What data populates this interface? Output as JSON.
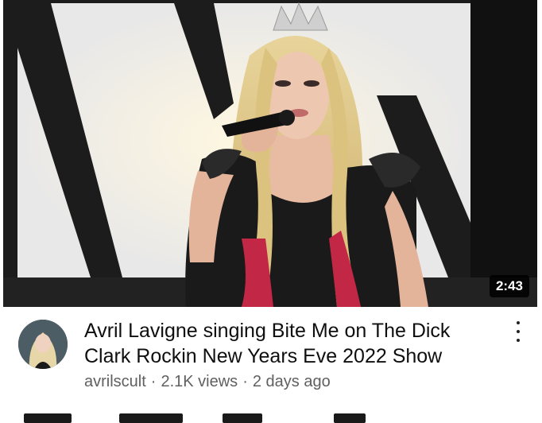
{
  "video": {
    "duration": "2:43",
    "thumbnail_icon": "concert-performance-thumbnail",
    "title": "Avril Lavigne singing Bite Me on The Dick Clark Rockin New Years Eve 2022 Show",
    "channel": "avrilscult",
    "views": "2.1K views",
    "age": "2 days ago",
    "separator": "·"
  },
  "icons": {
    "more": "more-vert-icon",
    "avatar": "channel-avatar"
  },
  "colors": {
    "title": "#0f0f0f",
    "meta": "#606060",
    "duration_bg": "#000000"
  }
}
